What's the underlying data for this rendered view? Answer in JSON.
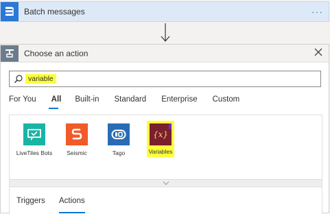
{
  "step": {
    "title": "Batch messages",
    "more": "···"
  },
  "panel": {
    "title": "Choose an action",
    "search": {
      "value": "variable"
    },
    "tabs": [
      {
        "label": "For You"
      },
      {
        "label": "All",
        "active": true
      },
      {
        "label": "Built-in"
      },
      {
        "label": "Standard"
      },
      {
        "label": "Enterprise"
      },
      {
        "label": "Custom"
      }
    ],
    "connectors": [
      {
        "label": "LiveTiles Bots",
        "color": "#19b4a4",
        "icon": "livetiles-bots-icon"
      },
      {
        "label": "Seismic",
        "color": "#f15a29",
        "icon": "seismic-icon"
      },
      {
        "label": "Tago",
        "color": "#2a6cb4",
        "icon": "tago-icon"
      },
      {
        "label": "Variables",
        "color": "#7a1f2b",
        "icon": "variables-icon",
        "glyph": "{x}"
      }
    ],
    "subtabs": [
      {
        "label": "Triggers"
      },
      {
        "label": "Actions",
        "active": true
      }
    ]
  },
  "colors": {
    "accent": "#0078d4",
    "highlight": "#fbff3b"
  }
}
